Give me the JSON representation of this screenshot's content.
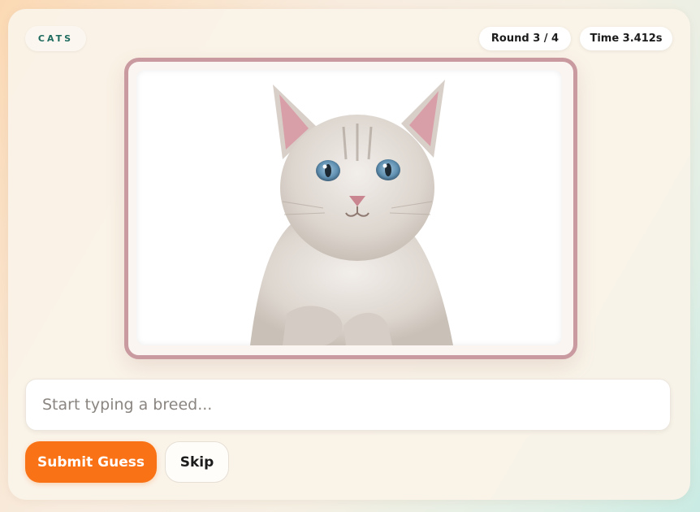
{
  "category": {
    "label": "CATS"
  },
  "status": {
    "round": "Round 3 / 4",
    "time": "Time 3.412s"
  },
  "image": {
    "subject": "cat-photo",
    "colors": {
      "frame": "#c99aa0",
      "background": "#ffffff"
    }
  },
  "guess": {
    "placeholder": "Start typing a breed...",
    "value": ""
  },
  "actions": {
    "submit_label": "Submit Guess",
    "skip_label": "Skip"
  },
  "theme": {
    "accent": "#f97316",
    "chip_text": "#1f6b5f"
  }
}
